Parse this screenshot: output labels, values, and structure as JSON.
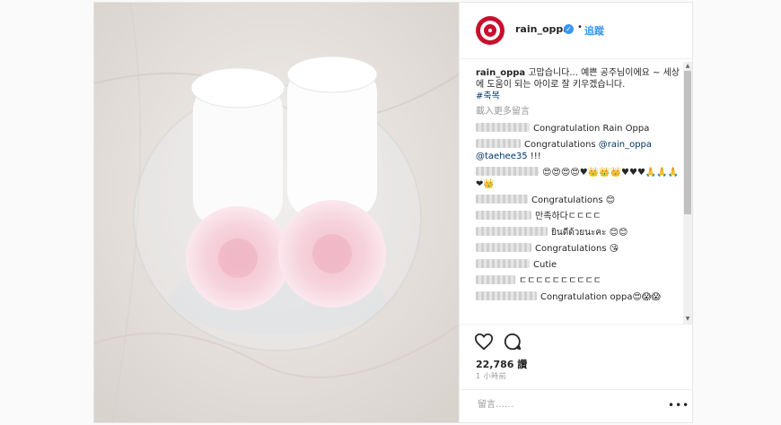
{
  "post": {
    "username": "rain_oppa",
    "follow_label": "追蹤",
    "dot": "•",
    "verified_icon": "verified-badge-icon",
    "caption_user": "rain_oppa",
    "caption_text": "고맙습니다... 예쁜 공주님이에요 ~ 세상에 도움이 되는 아이로 잘 키우겠습니다.",
    "hashtag": "#축복",
    "load_more": "載入更多留言",
    "likes": "22,786 讚",
    "time": "1 小時前",
    "comment_placeholder": "留言……",
    "more_label": "•••"
  },
  "comments": [
    {
      "text": "Congratulation Rain Oppa"
    },
    {
      "text": "Congratulations ",
      "mention": "@rain_oppa",
      "text2": "",
      "mention2": "@taehee35",
      "text3": " !!!"
    },
    {
      "text": "😍😍😍😍♥👑👑👑♥♥♥🙏🙏🙏❤👑"
    },
    {
      "text": "Congratulations 😊"
    },
    {
      "text": "만족하다ㄷㄷㄷㄷ"
    },
    {
      "text": "ยินดีด้วยนะคะ 😊😊"
    },
    {
      "text": "Congratulations 😘"
    },
    {
      "text": "Cutie"
    },
    {
      "text": "ㄷㄷㄷㄷㄷㄷㄷㄷㄷㄷ"
    },
    {
      "text": "Congratulation oppa😍😱😱"
    }
  ],
  "colors": {
    "accent": "#3897f0",
    "avatar": "#c8102e",
    "link": "#003569"
  }
}
